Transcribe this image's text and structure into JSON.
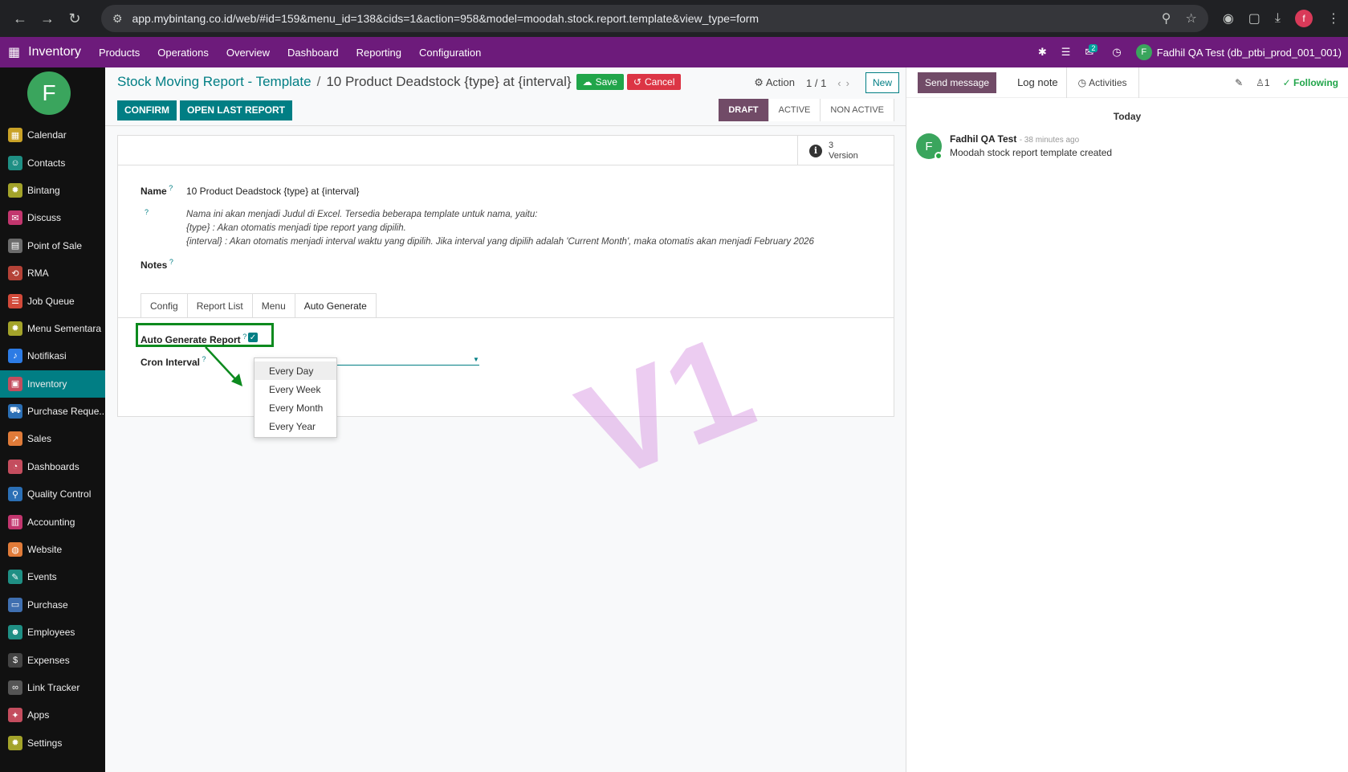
{
  "browser": {
    "url": "app.mybintang.co.id/web/#id=159&menu_id=138&cids=1&action=958&model=moodah.stock.report.template&view_type=form",
    "profile_initial": "f"
  },
  "topmenu": {
    "app_name": "Inventory",
    "items": [
      "Products",
      "Operations",
      "Overview",
      "Dashboard",
      "Reporting",
      "Configuration"
    ],
    "message_count": "2",
    "user_initial": "F",
    "user_label": "Fadhil QA Test (db_ptbi_prod_001_001)"
  },
  "sidebar": {
    "avatar_initial": "F",
    "items": [
      {
        "label": "Calendar",
        "color": "#c9a227",
        "icon": "calendar-icon",
        "glyph": "▦"
      },
      {
        "label": "Contacts",
        "color": "#1f8f84",
        "icon": "contacts-icon",
        "glyph": "☺"
      },
      {
        "label": "Bintang",
        "color": "#a3a32a",
        "icon": "gear-icon",
        "glyph": "✹"
      },
      {
        "label": "Discuss",
        "color": "#c2366e",
        "icon": "discuss-icon",
        "glyph": "✉"
      },
      {
        "label": "Point of Sale",
        "color": "#6b6b6b",
        "icon": "pos-icon",
        "glyph": "▤"
      },
      {
        "label": "RMA",
        "color": "#b44237",
        "icon": "rma-icon",
        "glyph": "⟲"
      },
      {
        "label": "Job Queue",
        "color": "#d24a3a",
        "icon": "list-icon",
        "glyph": "☰"
      },
      {
        "label": "Menu Sementara",
        "color": "#a3a32a",
        "icon": "gear-icon",
        "glyph": "✹"
      },
      {
        "label": "Notifikasi",
        "color": "#2c7be5",
        "icon": "bell-icon",
        "glyph": "♪"
      },
      {
        "label": "Inventory",
        "color": "#c44d5e",
        "icon": "inventory-icon",
        "glyph": "▣"
      },
      {
        "label": "Purchase Reque...",
        "color": "#2b6fb5",
        "icon": "cart-icon",
        "glyph": "⛟"
      },
      {
        "label": "Sales",
        "color": "#e07b39",
        "icon": "sales-icon",
        "glyph": "↗"
      },
      {
        "label": "Dashboards",
        "color": "#c44d5e",
        "icon": "dashboard-icon",
        "glyph": "◔"
      },
      {
        "label": "Quality Control",
        "color": "#2b6fb5",
        "icon": "quality-icon",
        "glyph": "⚲"
      },
      {
        "label": "Accounting",
        "color": "#c2366e",
        "icon": "accounting-icon",
        "glyph": "▥"
      },
      {
        "label": "Website",
        "color": "#e07b39",
        "icon": "website-icon",
        "glyph": "◍"
      },
      {
        "label": "Events",
        "color": "#1f8f84",
        "icon": "events-icon",
        "glyph": "✎"
      },
      {
        "label": "Purchase",
        "color": "#3f6fb0",
        "icon": "purchase-icon",
        "glyph": "▭"
      },
      {
        "label": "Employees",
        "color": "#1f8f84",
        "icon": "employees-icon",
        "glyph": "☻"
      },
      {
        "label": "Expenses",
        "color": "#444444",
        "icon": "expenses-icon",
        "glyph": "$"
      },
      {
        "label": "Link Tracker",
        "color": "#555555",
        "icon": "link-icon",
        "glyph": "∞"
      },
      {
        "label": "Apps",
        "color": "#c44d5e",
        "icon": "apps-icon",
        "glyph": "✦"
      },
      {
        "label": "Settings",
        "color": "#a3a32a",
        "icon": "gear-icon",
        "glyph": "✹"
      }
    ]
  },
  "form": {
    "breadcrumb_parent": "Stock Moving Report - Template",
    "breadcrumb_current": "10 Product Deadstock {type} at {interval}",
    "save_label": "Save",
    "cancel_label": "Cancel",
    "action_label": "Action",
    "pager": "1 / 1",
    "new_label": "New",
    "confirm_label": "CONFIRM",
    "open_last_label": "OPEN LAST REPORT",
    "status_stages": [
      "DRAFT",
      "ACTIVE",
      "NON ACTIVE"
    ],
    "status_current": "DRAFT",
    "version_count": "3",
    "version_label": "Version",
    "name_label": "Name",
    "name_value": "10 Product Deadstock {type} at {interval}",
    "help_lines": [
      "Nama ini akan menjadi Judul di Excel. Tersedia beberapa template untuk nama, yaitu:",
      "{type}   : Akan otomatis menjadi tipe report yang dipilih.",
      "{interval} : Akan otomatis menjadi interval waktu yang dipilih. Jika interval yang dipilih adalah 'Current Month', maka otomatis akan menjadi February 2026"
    ],
    "notes_label": "Notes",
    "tabs": [
      "Config",
      "Report List",
      "Menu",
      "Auto Generate"
    ],
    "active_tab": "Auto Generate",
    "auto_generate_label": "Auto Generate Report",
    "auto_generate_checked": true,
    "cron_label": "Cron Interval",
    "cron_options": [
      "Every Day",
      "Every Week",
      "Every Month",
      "Every Year"
    ],
    "cron_hover": "Every Day",
    "watermark": "V1"
  },
  "chatter": {
    "send_label": "Send message",
    "log_label": "Log note",
    "activities_label": "Activities",
    "followers_count": "1",
    "following_label": "Following",
    "date_separator": "Today",
    "message": {
      "author": "Fadhil QA Test",
      "time": "- 38 minutes ago",
      "text": "Moodah stock report template created",
      "initial": "F"
    }
  },
  "colors": {
    "brand": "#6d1b7b",
    "accent": "#017e84",
    "highlight": "#0c8a1e"
  }
}
